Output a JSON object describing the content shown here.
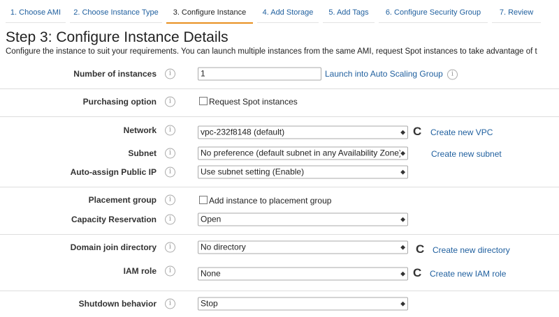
{
  "tabs": [
    "1. Choose AMI",
    "2. Choose Instance Type",
    "3. Configure Instance",
    "4. Add Storage",
    "5. Add Tags",
    "6. Configure Security Group",
    "7. Review"
  ],
  "title": "Step 3: Configure Instance Details",
  "description": "Configure the instance to suit your requirements. You can launch multiple instances from the same AMI, request Spot instances to take advantage of t",
  "rows": {
    "instances": {
      "label": "Number of instances",
      "value": "1",
      "link": "Launch into Auto Scaling Group"
    },
    "purchasing": {
      "label": "Purchasing option",
      "checkbox": "Request Spot instances"
    },
    "network": {
      "label": "Network",
      "value": "vpc-232f8148 (default)",
      "link": "Create new VPC"
    },
    "subnet": {
      "label": "Subnet",
      "value": "No preference (default subnet in any Availability Zone)",
      "link": "Create new subnet"
    },
    "publicip": {
      "label": "Auto-assign Public IP",
      "value": "Use subnet setting (Enable)"
    },
    "placement": {
      "label": "Placement group",
      "checkbox": "Add instance to placement group"
    },
    "capacity": {
      "label": "Capacity Reservation",
      "value": "Open"
    },
    "domain": {
      "label": "Domain join directory",
      "value": "No directory",
      "link": "Create new directory"
    },
    "iam": {
      "label": "IAM role",
      "value": "None",
      "link": "Create new IAM role"
    },
    "shutdown": {
      "label": "Shutdown behavior",
      "value": "Stop"
    }
  },
  "info_glyph": "i",
  "refresh_glyph": "C",
  "arrow_glyph": "◆"
}
